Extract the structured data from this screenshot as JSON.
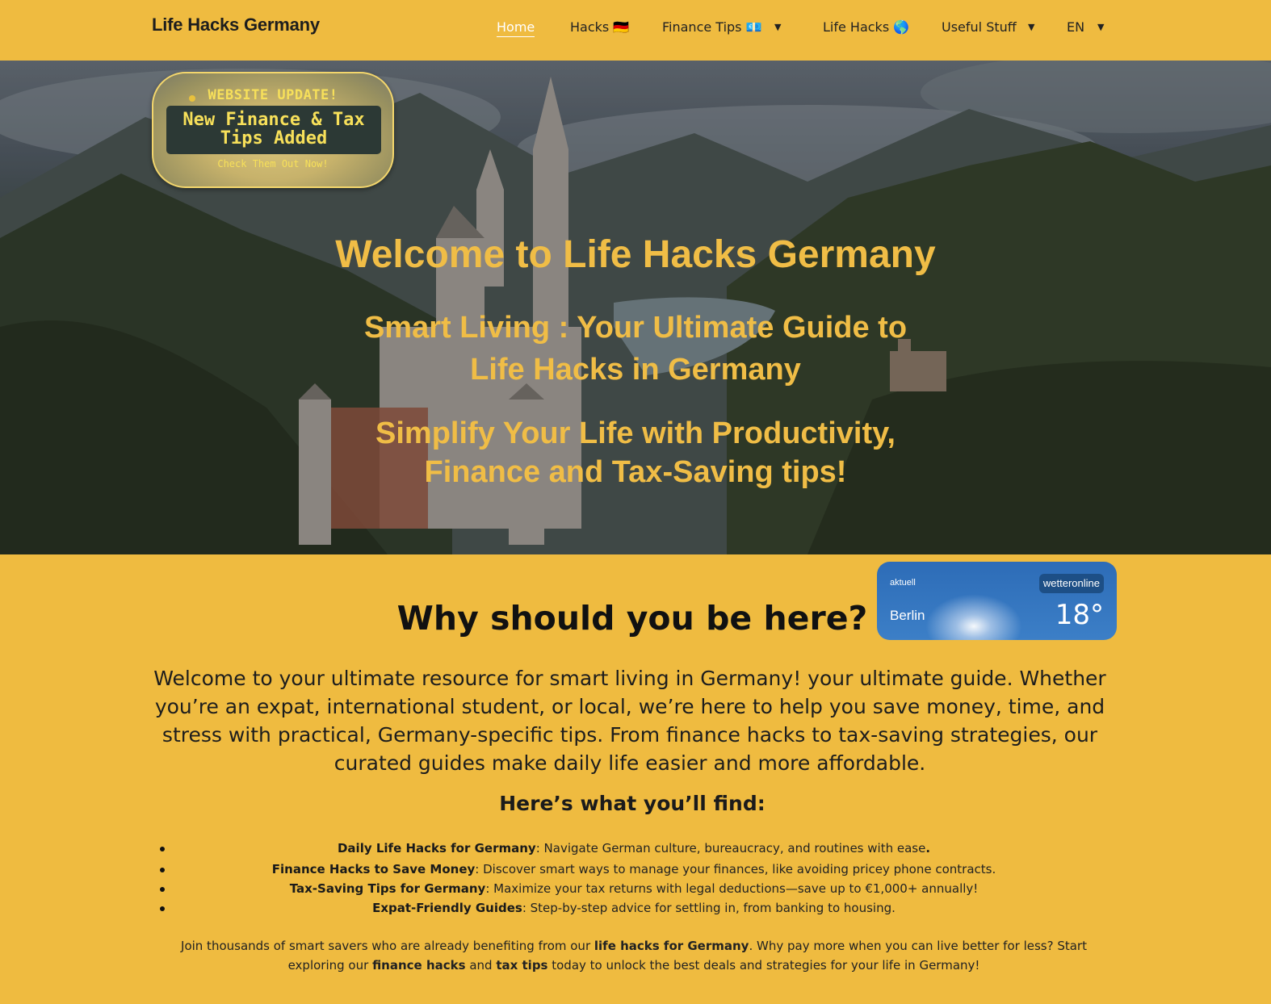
{
  "header": {
    "logo": "Life Hacks Germany",
    "nav": {
      "home": "Home",
      "hacks": "Hacks 🇩🇪",
      "finance_tips": "Finance Tips 💶",
      "life_hacks": "Life Hacks 🌎",
      "useful_stuff": "Useful Stuff",
      "language": "EN"
    }
  },
  "update_badge": {
    "top": "WEBSITE UPDATE!",
    "main_line1": "New Finance & Tax",
    "main_line2": "Tips Added",
    "cta": "Check Them Out Now!"
  },
  "hero": {
    "title": "Welcome to Life Hacks Germany",
    "subtitle_line1": "Smart Living : Your Ultimate Guide to",
    "subtitle_line2": "Life Hacks in Germany",
    "tagline_line1": "Simplify Your Life with Productivity,",
    "tagline_line2": "Finance  and Tax-Saving tips!"
  },
  "weather": {
    "label": "aktuell",
    "brand": "wetteronline",
    "city": "Berlin",
    "temperature": "18°"
  },
  "content": {
    "heading": "Why should you be here?",
    "intro": "Welcome to your ultimate resource for smart living in Germany! your ultimate guide. Whether you’re an expat, international student, or local, we’re here to help you save money, time, and stress with practical, Germany-specific tips. From finance hacks to tax-saving strategies, our curated guides make daily life easier and more affordable.",
    "find_heading": "Here’s what you’ll find:",
    "items": [
      {
        "title": "Daily Life Hacks for Germany",
        "text": ":  Navigate German culture, bureaucracy, and routines with ease",
        "end": "."
      },
      {
        "title": "Finance Hacks to Save Money",
        "text": ": Discover smart ways to manage your finances, like avoiding pricey phone contracts.",
        "end": ""
      },
      {
        "title": "Tax-Saving Tips for Germany",
        "text": ": Maximize your tax returns with legal deductions—save up to €1,000+ annually!",
        "end": ""
      },
      {
        "title": "Expat-Friendly Guides",
        "text": ": Step-by-step advice for settling in, from banking to housing.",
        "end": ""
      }
    ],
    "outro": {
      "part1": "Join thousands of smart savers who are already benefiting from our ",
      "bold1": "life hacks for Germany",
      "part2": ". Why pay more when you can live better for less? Start exploring our ",
      "bold2": "finance hacks",
      "part3": " and ",
      "bold3": "tax tips",
      "part4": " today to unlock the best deals and strategies for your life in Germany!"
    }
  },
  "colors": {
    "background": "#efbb40",
    "hero_text": "#f0bd46",
    "badge_text": "#f7e05a",
    "weather_blue": "#2d6cb7"
  }
}
